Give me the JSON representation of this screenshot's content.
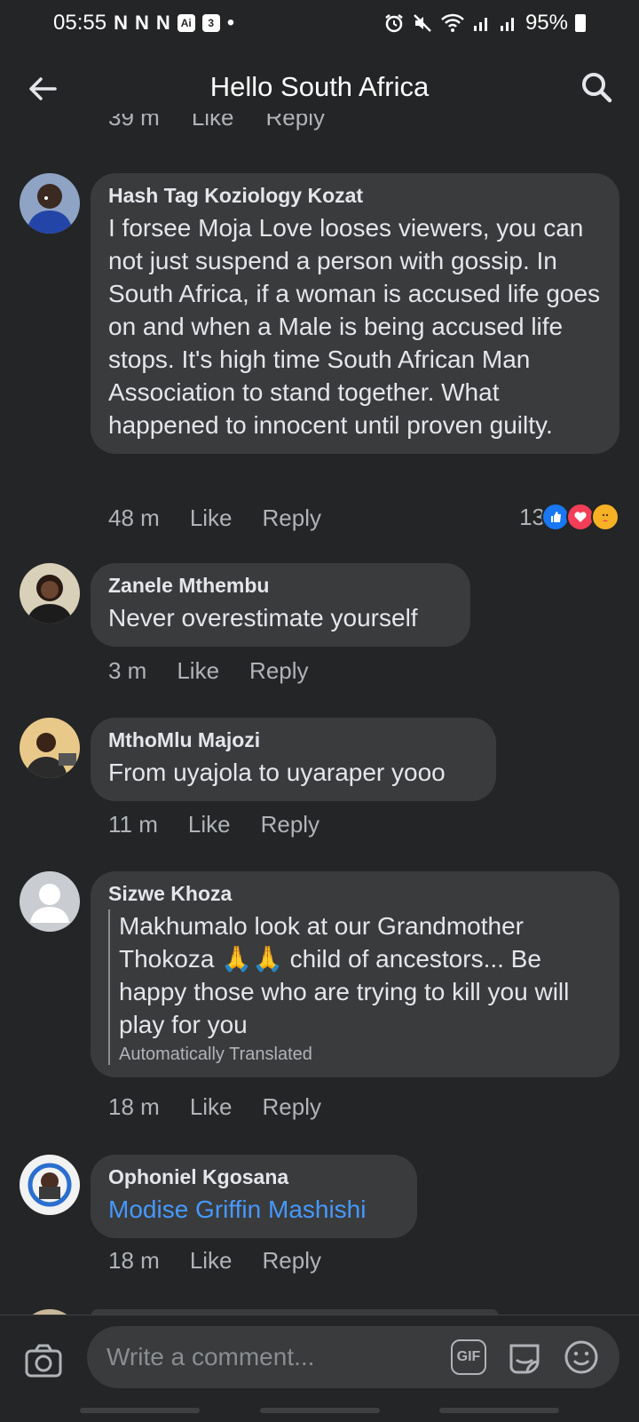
{
  "status_bar": {
    "time": "05:55",
    "battery": "95%",
    "notification_glyphs": [
      "N",
      "N",
      "N"
    ],
    "box_glyphs": [
      "Ai",
      "3"
    ]
  },
  "header": {
    "title": "Hello South Africa"
  },
  "previous_meta": {
    "time": "39 m",
    "like": "Like",
    "reply": "Reply"
  },
  "comments": [
    {
      "author": "Hash Tag Koziology Kozat",
      "text": "I forsee Moja Love looses viewers, you can not just suspend a person with gossip. In South Africa, if a woman is accused life goes on and when a Male is being accused life stops. It's high time South African Man Association to stand together. What happened to innocent until proven guilty.",
      "time": "48 m",
      "like": "Like",
      "reply": "Reply",
      "reaction_count": "13"
    },
    {
      "author": "Zanele Mthembu",
      "text": "Never overestimate yourself",
      "time": "3 m",
      "like": "Like",
      "reply": "Reply"
    },
    {
      "author": "MthoMlu Majozi",
      "text": "From uyajola to uyaraper yooo",
      "time": "11 m",
      "like": "Like",
      "reply": "Reply"
    },
    {
      "author": "Sizwe Khoza",
      "text": "Makhumalo look at our Grandmother Thokoza 🙏🙏 child of ancestors... Be happy those who are trying to kill you will play for you",
      "translation_note": "Automatically Translated",
      "time": "18 m",
      "like": "Like",
      "reply": "Reply"
    },
    {
      "author": "Ophoniel Kgosana",
      "text": "Modise Griffin Mashishi",
      "time": "18 m",
      "like": "Like",
      "reply": "Reply"
    }
  ],
  "composer": {
    "placeholder": "Write a comment...",
    "gif_label": "GIF"
  },
  "colors": {
    "background": "#242526",
    "bubble": "#3a3b3c",
    "link": "#4599ff",
    "like_reaction": "#1877f2",
    "love_reaction": "#f33e58",
    "care_reaction": "#f7b125"
  }
}
